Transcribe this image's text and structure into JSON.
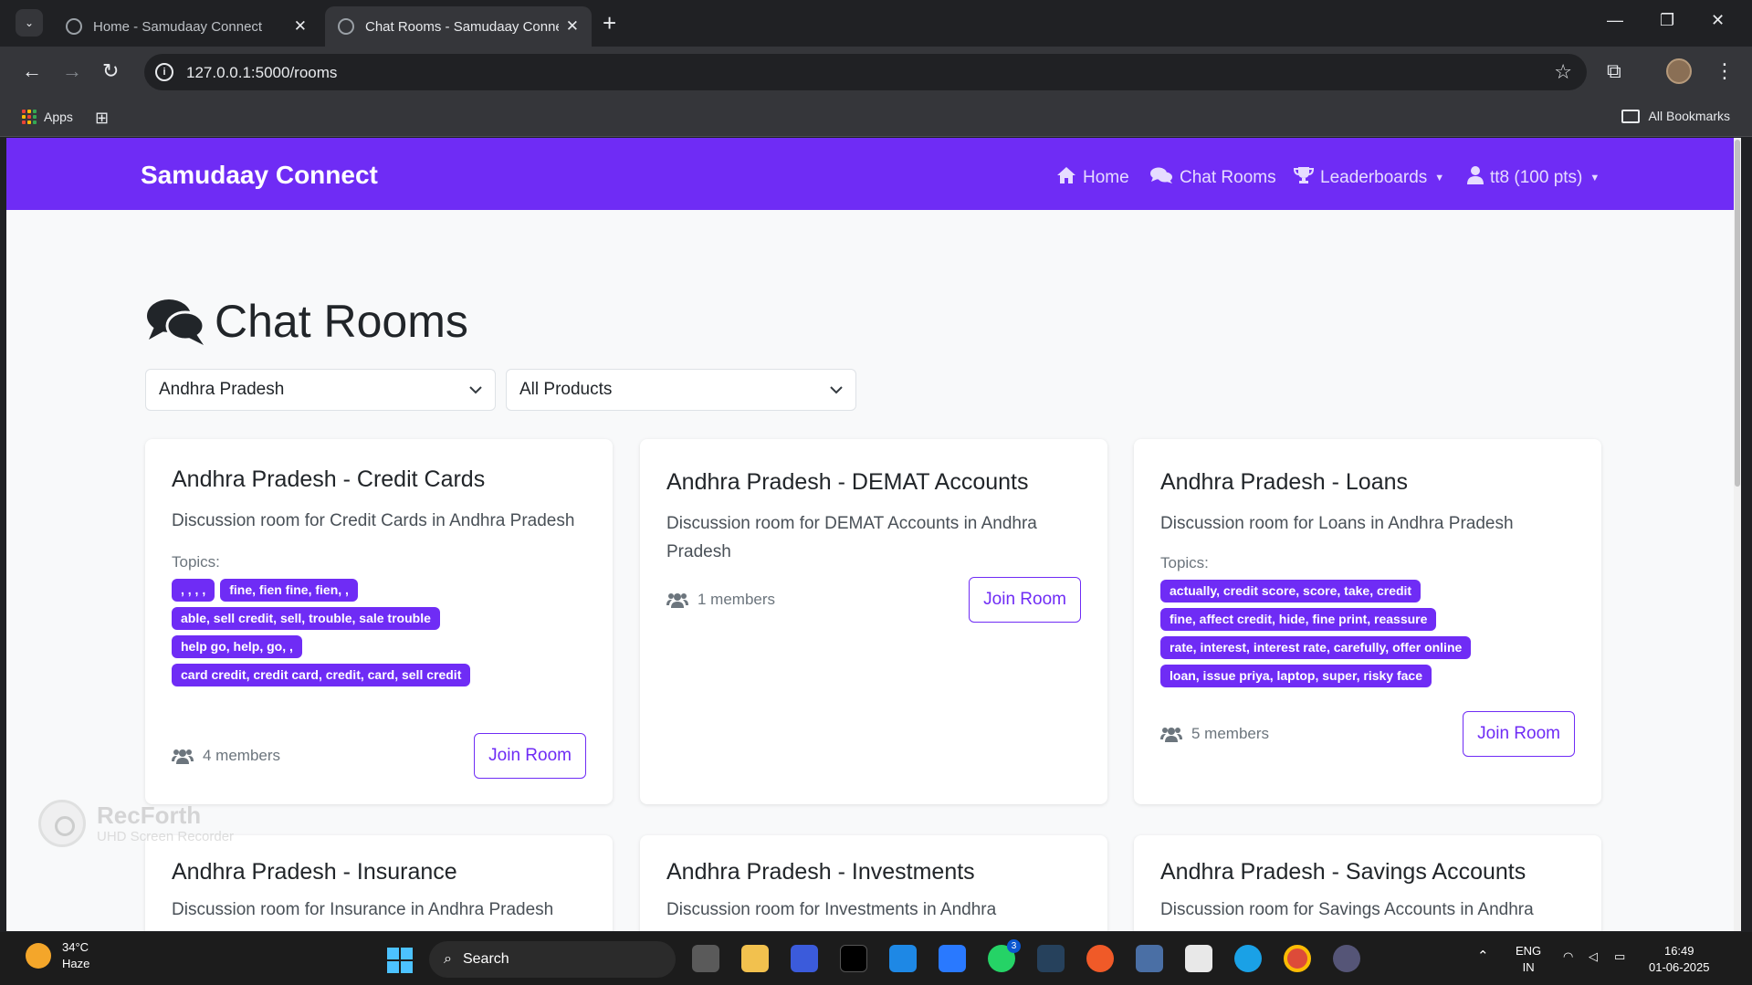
{
  "browser": {
    "tabs": [
      {
        "title": "Home - Samudaay Connect",
        "active": false
      },
      {
        "title": "Chat Rooms - Samudaay Connect",
        "active": true
      }
    ],
    "url": "127.0.0.1:5000/rooms",
    "bookmarks": {
      "apps_label": "Apps",
      "all_bookmarks_label": "All Bookmarks"
    }
  },
  "navbar": {
    "brand": "Samudaay Connect",
    "items": [
      {
        "label": "Home",
        "icon": "home-icon"
      },
      {
        "label": "Chat Rooms",
        "icon": "comments-icon"
      },
      {
        "label": "Leaderboards",
        "icon": "trophy-icon"
      },
      {
        "label": "tt8 (100 pts)",
        "icon": "user-icon"
      }
    ]
  },
  "page": {
    "title": "Chat Rooms",
    "filters": {
      "state": "Andhra Pradesh",
      "product": "All Products"
    }
  },
  "rooms": [
    {
      "title": "Andhra Pradesh - Credit Cards",
      "description": "Discussion room for Credit Cards in Andhra Pradesh",
      "topics_label": "Topics:",
      "topics": [
        ", , , ,",
        "fine, fien fine, fien, ,",
        "able, sell credit, sell, trouble, sale trouble",
        "help go, help, go, ,",
        "card credit, credit card, credit, card, sell credit"
      ],
      "members": "4 members",
      "join_label": "Join Room"
    },
    {
      "title": "Andhra Pradesh - DEMAT Accounts",
      "description": "Discussion room for DEMAT Accounts in Andhra Pradesh",
      "topics_label": "",
      "topics": [],
      "members": "1 members",
      "join_label": "Join Room"
    },
    {
      "title": "Andhra Pradesh - Loans",
      "description": "Discussion room for Loans in Andhra Pradesh",
      "topics_label": "Topics:",
      "topics": [
        "actually, credit score, score, take, credit",
        "fine, affect credit, hide, fine print, reassure",
        "rate, interest, interest rate, carefully, offer online",
        "loan, issue priya, laptop, super, risky face"
      ],
      "members": "5 members",
      "join_label": "Join Room"
    },
    {
      "title": "Andhra Pradesh - Insurance",
      "description": "Discussion room for Insurance in Andhra Pradesh"
    },
    {
      "title": "Andhra Pradesh - Investments",
      "description": "Discussion room for Investments in Andhra"
    },
    {
      "title": "Andhra Pradesh - Savings Accounts",
      "description": "Discussion room for Savings Accounts in Andhra"
    }
  ],
  "watermark": {
    "name": "RecForth",
    "sub": "UHD Screen Recorder"
  },
  "taskbar": {
    "weather_temp": "34°C",
    "weather_cond": "Haze",
    "search_label": "Search",
    "lang_top": "ENG",
    "lang_bottom": "IN",
    "time": "16:49",
    "date": "01-06-2025",
    "whatsapp_badge": "3"
  },
  "colors": {
    "brand": "#6f2cf5",
    "badge": "#6f2cf5",
    "page_bg": "#f8f9fa"
  }
}
